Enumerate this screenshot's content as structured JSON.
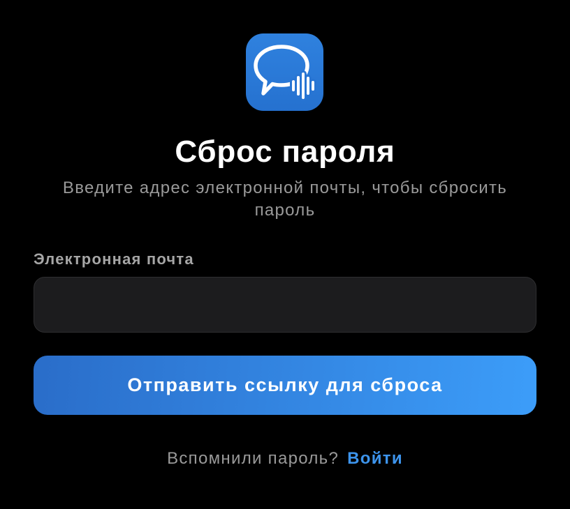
{
  "logo": {
    "icon": "chat-bubble-soundwave-icon"
  },
  "header": {
    "title": "Сброс пароля",
    "subtitle": "Введите адрес электронной почты, чтобы сбросить пароль"
  },
  "form": {
    "email_label": "Электронная почта",
    "email_value": "",
    "submit_label": "Отправить ссылку для сброса"
  },
  "footer": {
    "prompt": "Вспомнили пароль?",
    "login_link": "Войти"
  },
  "colors": {
    "background": "#000000",
    "title_text": "#ffffff",
    "secondary_text": "#9a9a9a",
    "label_text": "#a6a6a6",
    "input_background": "#1c1c1e",
    "input_border": "#2e2e30",
    "button_gradient_start": "#2a6dc9",
    "button_gradient_end": "#3c9df9",
    "accent": "#3d94ec",
    "logo_background": "#2a79d7"
  }
}
